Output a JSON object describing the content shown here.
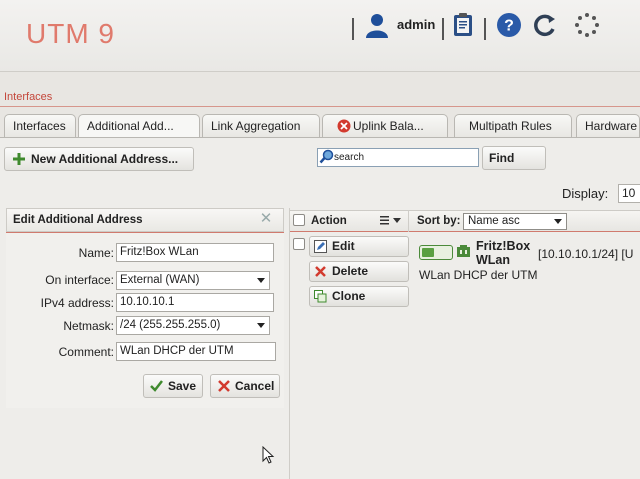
{
  "header": {
    "brand": "UTM 9",
    "user_name": "admin"
  },
  "section": {
    "title": "Interfaces"
  },
  "tabs": [
    {
      "label": "Interfaces"
    },
    {
      "label": "Additional Add..."
    },
    {
      "label": "Link Aggregation"
    },
    {
      "label": "Uplink Bala..."
    },
    {
      "label": "Multipath Rules"
    },
    {
      "label": "Hardware"
    }
  ],
  "toolbar": {
    "new_label": "New Additional Address...",
    "search_value": "search",
    "find_label": "Find",
    "display_label": "Display:",
    "display_value": "10"
  },
  "edit_panel": {
    "title": "Edit Additional Address",
    "name_label": "Name:",
    "name_value": "Fritz!Box WLan",
    "interface_label": "On interface:",
    "interface_value": "External (WAN)",
    "ipv4_label": "IPv4 address:",
    "ipv4_value": "10.10.10.1",
    "netmask_label": "Netmask:",
    "netmask_value": "/24 (255.255.255.0)",
    "comment_label": "Comment:",
    "comment_value": "WLan DHCP der UTM",
    "save_label": "Save",
    "cancel_label": "Cancel"
  },
  "list": {
    "action_header": "Action",
    "sort_label": "Sort by:",
    "sort_value": "Name asc",
    "actions": {
      "edit": "Edit",
      "delete": "Delete",
      "clone": "Clone"
    },
    "entry": {
      "name": "Fritz!Box WLan",
      "ip": "[10.10.10.1/24] [U",
      "comment": "WLan DHCP der UTM",
      "enabled": true
    }
  },
  "colors": {
    "brand": "#e07a6c",
    "accent_line": "#d07a6e",
    "help_icon": "#2a5aa8",
    "toggle_on": "#5aa042"
  }
}
